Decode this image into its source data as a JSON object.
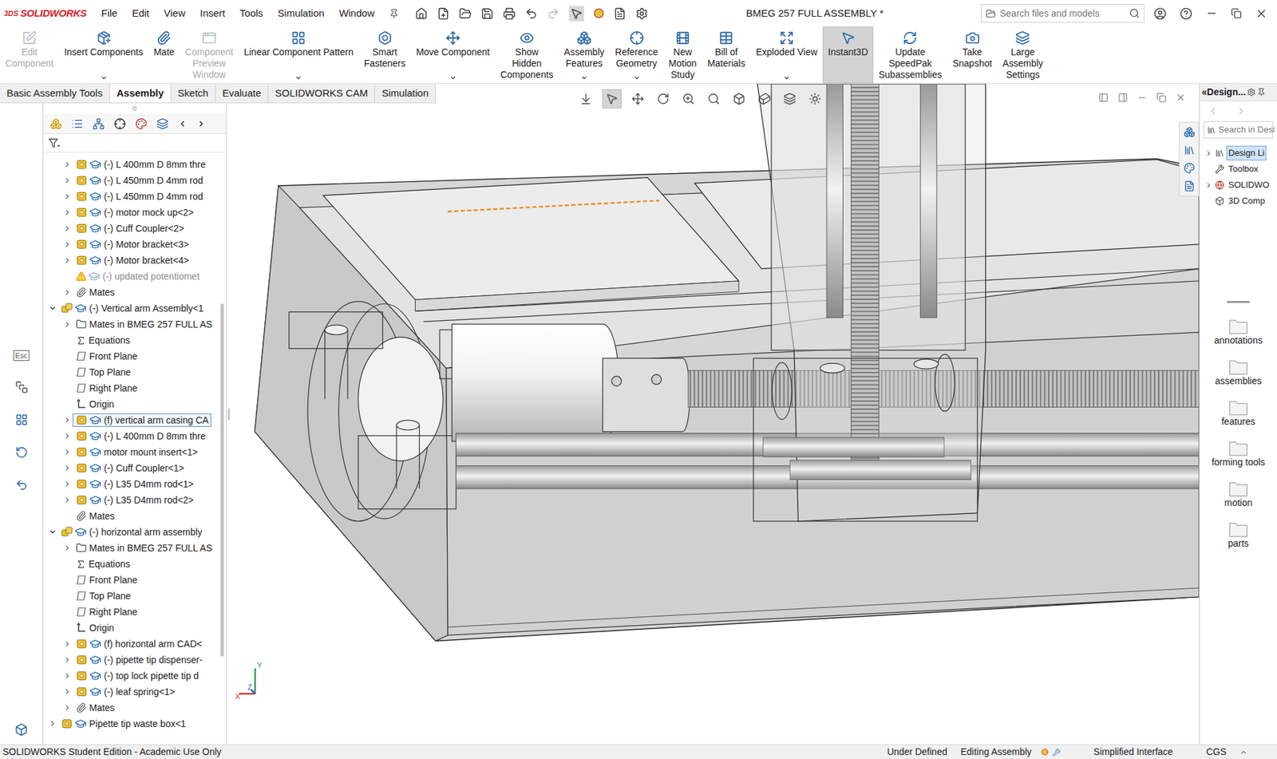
{
  "window": {
    "title": "BMEG 257 FULL ASSEMBLY *"
  },
  "logo": {
    "mark": "3DS",
    "name": "SOLIDWORKS"
  },
  "menu": [
    "File",
    "Edit",
    "View",
    "Insert",
    "Tools",
    "Simulation",
    "Window"
  ],
  "search": {
    "placeholder": "Search files and models"
  },
  "commands": [
    {
      "lines": [
        "Edit",
        "Component"
      ],
      "disabled": true,
      "selected": false,
      "dropdown": false
    },
    {
      "lines": [
        "Insert Components"
      ],
      "disabled": false,
      "selected": false,
      "dropdown": true
    },
    {
      "lines": [
        "Mate"
      ],
      "disabled": false,
      "selected": false,
      "dropdown": false
    },
    {
      "lines": [
        "Component",
        "Preview",
        "Window"
      ],
      "disabled": true,
      "selected": false,
      "dropdown": false
    },
    {
      "lines": [
        "Linear Component Pattern"
      ],
      "disabled": false,
      "selected": false,
      "dropdown": true
    },
    {
      "lines": [
        "Smart",
        "Fasteners"
      ],
      "disabled": false,
      "selected": false,
      "dropdown": false
    },
    {
      "lines": [
        "Move Component"
      ],
      "disabled": false,
      "selected": false,
      "dropdown": true
    },
    {
      "lines": [
        "Show",
        "Hidden",
        "Components"
      ],
      "disabled": false,
      "selected": false,
      "dropdown": false
    },
    {
      "lines": [
        "Assembly",
        "Features"
      ],
      "disabled": false,
      "selected": false,
      "dropdown": true
    },
    {
      "lines": [
        "Reference",
        "Geometry"
      ],
      "disabled": false,
      "selected": false,
      "dropdown": true
    },
    {
      "lines": [
        "New",
        "Motion",
        "Study"
      ],
      "disabled": false,
      "selected": false,
      "dropdown": false
    },
    {
      "lines": [
        "Bill of",
        "Materials"
      ],
      "disabled": false,
      "selected": false,
      "dropdown": false
    },
    {
      "lines": [
        "Exploded View"
      ],
      "disabled": false,
      "selected": false,
      "dropdown": true
    },
    {
      "lines": [
        "Instant3D"
      ],
      "disabled": false,
      "selected": true,
      "dropdown": false
    },
    {
      "lines": [
        "Update",
        "SpeedPak",
        "Subassemblies"
      ],
      "disabled": false,
      "selected": false,
      "dropdown": false
    },
    {
      "lines": [
        "Take",
        "Snapshot"
      ],
      "disabled": false,
      "selected": false,
      "dropdown": false
    },
    {
      "lines": [
        "Large",
        "Assembly",
        "Settings"
      ],
      "disabled": false,
      "selected": false,
      "dropdown": false
    }
  ],
  "tabs": [
    {
      "label": "Basic Assembly Tools",
      "selected": false
    },
    {
      "label": "Assembly",
      "selected": true
    },
    {
      "label": "Sketch",
      "selected": false
    },
    {
      "label": "Evaluate",
      "selected": false
    },
    {
      "label": "SOLIDWORKS CAM",
      "selected": false
    },
    {
      "label": "Simulation",
      "selected": false
    }
  ],
  "side_strip": {
    "esc_label": "Esc"
  },
  "tree": [
    {
      "label": "(-) L 400mm D 8mm thre",
      "kind": "part",
      "level": 1,
      "expandable": true,
      "expanded": false,
      "suppressed": false,
      "selected": false
    },
    {
      "label": "(-) L 450mm D 4mm rod",
      "kind": "part",
      "level": 1,
      "expandable": true,
      "expanded": false,
      "suppressed": false,
      "selected": false
    },
    {
      "label": "(-) L 450mm D 4mm rod",
      "kind": "part",
      "level": 1,
      "expandable": true,
      "expanded": false,
      "suppressed": false,
      "selected": false
    },
    {
      "label": "(-) motor mock up<2>",
      "kind": "part",
      "level": 1,
      "expandable": true,
      "expanded": false,
      "suppressed": false,
      "selected": false
    },
    {
      "label": "(-) Cuff Coupler<2>",
      "kind": "part",
      "level": 1,
      "expandable": true,
      "expanded": false,
      "suppressed": false,
      "selected": false
    },
    {
      "label": "(-) Motor bracket<3>",
      "kind": "part",
      "level": 1,
      "expandable": true,
      "expanded": false,
      "suppressed": false,
      "selected": false
    },
    {
      "label": "(-) Motor bracket<4>",
      "kind": "part",
      "level": 1,
      "expandable": true,
      "expanded": false,
      "suppressed": false,
      "selected": false
    },
    {
      "label": "(-) updated potentiomet",
      "kind": "part",
      "level": 1,
      "expandable": false,
      "expanded": false,
      "suppressed": true,
      "selected": false
    },
    {
      "label": "Mates",
      "kind": "mates",
      "level": 1,
      "expandable": true,
      "expanded": false,
      "suppressed": false,
      "selected": false
    },
    {
      "label": "(-) Vertical arm Assembly<1",
      "kind": "assembly",
      "level": 0,
      "expandable": true,
      "expanded": true,
      "suppressed": false,
      "selected": false
    },
    {
      "label": "Mates in BMEG 257 FULL AS",
      "kind": "mates-folder",
      "level": 1,
      "expandable": true,
      "expanded": false,
      "suppressed": false,
      "selected": false
    },
    {
      "label": "Equations",
      "kind": "equations",
      "level": 1,
      "expandable": false,
      "expanded": false,
      "suppressed": false,
      "selected": false
    },
    {
      "label": "Front Plane",
      "kind": "plane",
      "level": 1,
      "expandable": false,
      "expanded": false,
      "suppressed": false,
      "selected": false
    },
    {
      "label": "Top Plane",
      "kind": "plane",
      "level": 1,
      "expandable": false,
      "expanded": false,
      "suppressed": false,
      "selected": false
    },
    {
      "label": "Right Plane",
      "kind": "plane",
      "level": 1,
      "expandable": false,
      "expanded": false,
      "suppressed": false,
      "selected": false
    },
    {
      "label": "Origin",
      "kind": "origin",
      "level": 1,
      "expandable": false,
      "expanded": false,
      "suppressed": false,
      "selected": false
    },
    {
      "label": "(f) vertical arm casing CA",
      "kind": "part",
      "level": 1,
      "expandable": true,
      "expanded": false,
      "suppressed": false,
      "selected": true
    },
    {
      "label": "(-) L 400mm D 8mm thre",
      "kind": "part",
      "level": 1,
      "expandable": true,
      "expanded": false,
      "suppressed": false,
      "selected": false
    },
    {
      "label": "motor mount insert<1>",
      "kind": "part",
      "level": 1,
      "expandable": true,
      "expanded": false,
      "suppressed": false,
      "selected": false
    },
    {
      "label": "(-) Cuff Coupler<1>",
      "kind": "part",
      "level": 1,
      "expandable": true,
      "expanded": false,
      "suppressed": false,
      "selected": false
    },
    {
      "label": "(-) L35 D4mm rod<1>",
      "kind": "part",
      "level": 1,
      "expandable": true,
      "expanded": false,
      "suppressed": false,
      "selected": false
    },
    {
      "label": "(-) L35 D4mm rod<2>",
      "kind": "part",
      "level": 1,
      "expandable": true,
      "expanded": false,
      "suppressed": false,
      "selected": false
    },
    {
      "label": "Mates",
      "kind": "mates",
      "level": 1,
      "expandable": false,
      "expanded": false,
      "suppressed": false,
      "selected": false
    },
    {
      "label": "(-) horizontal arm assembly",
      "kind": "assembly",
      "level": 0,
      "expandable": true,
      "expanded": true,
      "suppressed": false,
      "selected": false
    },
    {
      "label": "Mates in BMEG 257 FULL AS",
      "kind": "mates-folder",
      "level": 1,
      "expandable": true,
      "expanded": false,
      "suppressed": false,
      "selected": false
    },
    {
      "label": "Equations",
      "kind": "equations",
      "level": 1,
      "expandable": false,
      "expanded": false,
      "suppressed": false,
      "selected": false
    },
    {
      "label": "Front Plane",
      "kind": "plane",
      "level": 1,
      "expandable": false,
      "expanded": false,
      "suppressed": false,
      "selected": false
    },
    {
      "label": "Top Plane",
      "kind": "plane",
      "level": 1,
      "expandable": false,
      "expanded": false,
      "suppressed": false,
      "selected": false
    },
    {
      "label": "Right Plane",
      "kind": "plane",
      "level": 1,
      "expandable": false,
      "expanded": false,
      "suppressed": false,
      "selected": false
    },
    {
      "label": "Origin",
      "kind": "origin",
      "level": 1,
      "expandable": false,
      "expanded": false,
      "suppressed": false,
      "selected": false
    },
    {
      "label": "(f) horizontal arm CAD<",
      "kind": "part",
      "level": 1,
      "expandable": true,
      "expanded": false,
      "suppressed": false,
      "selected": false
    },
    {
      "label": "(-) pipette tip dispenser-",
      "kind": "part",
      "level": 1,
      "expandable": true,
      "expanded": false,
      "suppressed": false,
      "selected": false
    },
    {
      "label": "(-) top lock pipette tip d",
      "kind": "part",
      "level": 1,
      "expandable": true,
      "expanded": false,
      "suppressed": false,
      "selected": false
    },
    {
      "label": "(-) leaf spring<1>",
      "kind": "part",
      "level": 1,
      "expandable": true,
      "expanded": false,
      "suppressed": false,
      "selected": false
    },
    {
      "label": "Mates",
      "kind": "mates",
      "level": 1,
      "expandable": true,
      "expanded": false,
      "suppressed": false,
      "selected": false
    },
    {
      "label": "Pipette tip waste box<1",
      "kind": "part",
      "level": 0,
      "expandable": true,
      "expanded": false,
      "suppressed": false,
      "selected": false
    }
  ],
  "graphics": {
    "triad": [
      "X",
      "Y",
      "Z"
    ]
  },
  "task_pane": {
    "collapse_glyph": "«",
    "title": "Design...",
    "search_placeholder": "Search in Desi",
    "library": [
      {
        "label": "Design Li",
        "expandable": true,
        "selected": true
      },
      {
        "label": "Toolbox",
        "expandable": false,
        "selected": false
      },
      {
        "label": "SOLIDWO",
        "expandable": true,
        "selected": false
      },
      {
        "label": "3D Comp",
        "expandable": false,
        "selected": false
      }
    ],
    "folders": [
      "annotations",
      "assemblies",
      "features",
      "forming tools",
      "motion",
      "parts"
    ]
  },
  "status_bar": {
    "left": "SOLIDWORKS Student Edition - Academic Use Only",
    "items": [
      "Under Defined",
      "Editing Assembly",
      "Simplified Interface",
      "CGS"
    ]
  }
}
